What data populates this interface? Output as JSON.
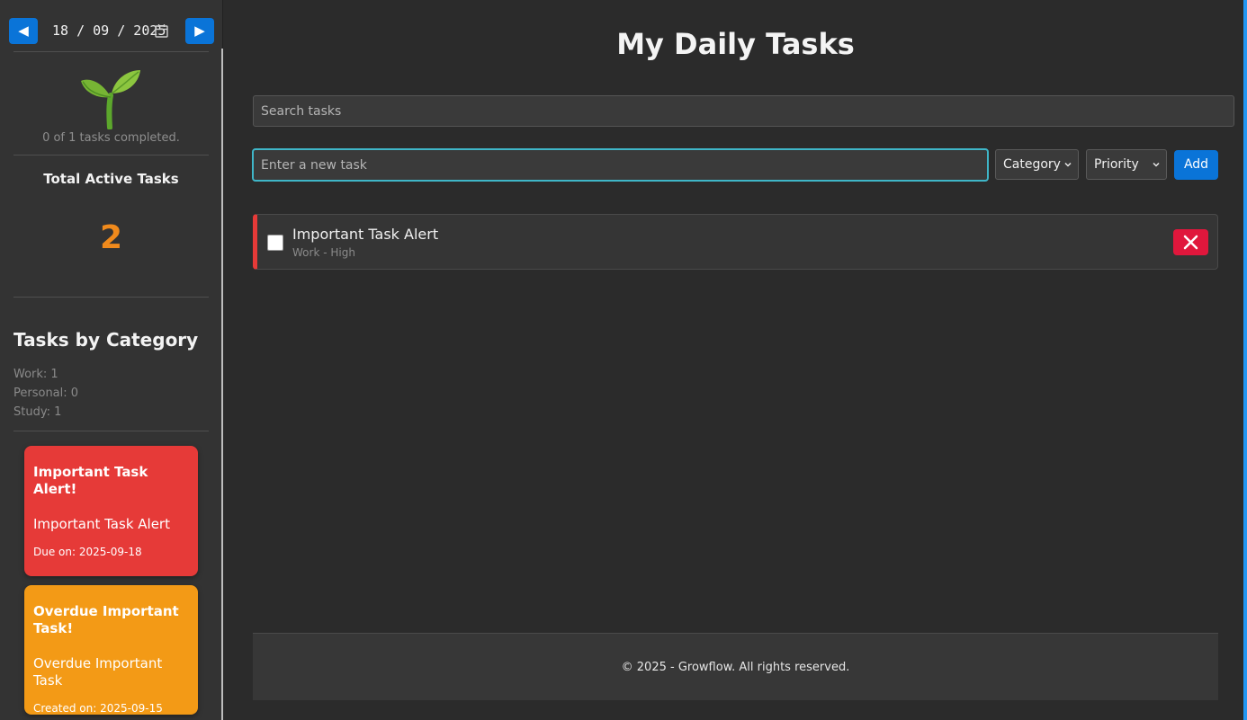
{
  "sidebar": {
    "date": {
      "prev_label": "◀",
      "next_label": "▶",
      "value": "18 / 09 / 2025",
      "calendar_icon": "calendar-icon"
    },
    "progress_text": "0 of 1 tasks completed.",
    "total_title": "Total Active Tasks",
    "total_count": "2",
    "category_title": "Tasks by Category",
    "categories": [
      {
        "label": "Work: 1"
      },
      {
        "label": "Personal: 0"
      },
      {
        "label": "Study: 1"
      }
    ],
    "alerts": [
      {
        "heading": "Important Task Alert!",
        "task": "Important Task Alert",
        "date": "Due on: 2025-09-18",
        "color": "#e63a38"
      },
      {
        "heading": "Overdue Important Task!",
        "task": "Overdue Important Task",
        "date": "Created on: 2025-09-15",
        "color": "#f39a16"
      }
    ]
  },
  "main": {
    "title": "My Daily Tasks",
    "search_placeholder": "Search tasks",
    "new_task_placeholder": "Enter a new task",
    "category_select": "Category",
    "priority_select": "Priority",
    "add_label": "Add",
    "tasks": [
      {
        "title": "Important Task Alert",
        "meta": "Work - High",
        "completed": false,
        "priority_color": "#e63a38"
      }
    ]
  },
  "footer": {
    "text": "© 2025 - Growflow. All rights reserved."
  },
  "colors": {
    "accent": "#0a74d8",
    "orange_count": "#f08a1c",
    "delete": "#e0173c",
    "focus_border": "#3fb6c8"
  }
}
